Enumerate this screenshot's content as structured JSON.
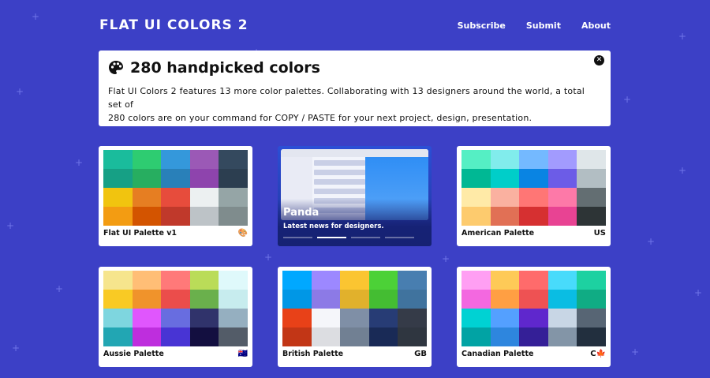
{
  "header": {
    "logo": "FLAT UI COLORS 2",
    "nav": [
      "Subscribe",
      "Submit",
      "About"
    ]
  },
  "intro": {
    "icon": "palette-icon",
    "title": "280 handpicked colors",
    "text_line1": "Flat UI Colors 2 features 13 more color palettes. Collaborating with 13 designers around the world, a total set of",
    "text_line2": "280 colors are on your command for COPY / PASTE for your next project, design, presentation.",
    "close_icon": "close-icon"
  },
  "ad": {
    "title": "Panda",
    "subtitle": "Latest news for designers."
  },
  "palettes": [
    {
      "name": "Flat UI Palette v1",
      "flag": "🎨",
      "colors": [
        "#1abc9c",
        "#2ecc71",
        "#3498db",
        "#9b59b6",
        "#34495e",
        "#16a085",
        "#27ae60",
        "#2980b9",
        "#8e44ad",
        "#2c3e50",
        "#f1c40f",
        "#e67e22",
        "#e74c3c",
        "#ecf0f1",
        "#95a5a6",
        "#f39c12",
        "#d35400",
        "#c0392b",
        "#bdc3c7",
        "#7f8c8d"
      ]
    },
    {
      "name": "American Palette",
      "flag": "US",
      "colors": [
        "#55efc4",
        "#81ecec",
        "#74b9ff",
        "#a29bfe",
        "#dfe6e9",
        "#00b894",
        "#00cec9",
        "#0984e3",
        "#6c5ce7",
        "#b2bec3",
        "#ffeaa7",
        "#fab1a0",
        "#ff7675",
        "#fd79a8",
        "#636e72",
        "#fdcb6e",
        "#e17055",
        "#d63031",
        "#e84393",
        "#2d3436"
      ]
    },
    {
      "name": "Aussie Palette",
      "flag": "🇦🇺",
      "colors": [
        "#f6e58d",
        "#ffbe76",
        "#ff7979",
        "#badc58",
        "#dff9fb",
        "#f9ca24",
        "#f0932b",
        "#eb4d4b",
        "#6ab04c",
        "#c7ecee",
        "#7ed6df",
        "#e056fd",
        "#686de0",
        "#30336b",
        "#95afc0",
        "#22a6b3",
        "#be2edd",
        "#4834d4",
        "#130f40",
        "#535c68"
      ]
    },
    {
      "name": "British Palette",
      "flag": "GB",
      "colors": [
        "#00a8ff",
        "#9c88ff",
        "#fbc531",
        "#4cd137",
        "#487eb0",
        "#0097e6",
        "#8c7ae6",
        "#e1b12c",
        "#44bd32",
        "#40739e",
        "#e84118",
        "#f5f6fa",
        "#7f8fa6",
        "#273c75",
        "#353b48",
        "#c23616",
        "#dcdde1",
        "#718093",
        "#192a56",
        "#2f3640"
      ]
    },
    {
      "name": "Canadian Palette",
      "flag": "C🍁",
      "colors": [
        "#ff9ff3",
        "#feca57",
        "#ff6b6b",
        "#48dbfb",
        "#1dd1a1",
        "#f368e0",
        "#ff9f43",
        "#ee5253",
        "#0abde3",
        "#10ac84",
        "#00d2d3",
        "#54a0ff",
        "#5f27cd",
        "#c8d6e5",
        "#576574",
        "#01a3a4",
        "#2e86de",
        "#341f97",
        "#8395a7",
        "#222f3e"
      ]
    }
  ]
}
